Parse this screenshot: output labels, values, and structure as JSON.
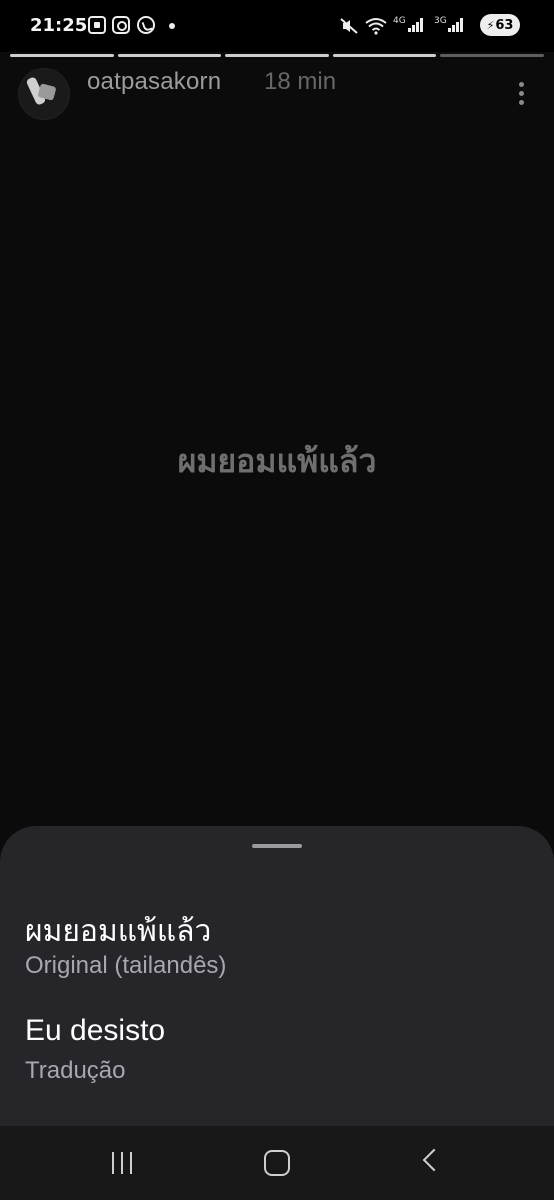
{
  "status_bar": {
    "time": "21:25",
    "left_icons": [
      "screenshot-icon",
      "instagram-icon",
      "whatsapp-icon"
    ],
    "network_labels": [
      "4G",
      "3G"
    ],
    "battery": "63"
  },
  "story": {
    "progress_segments": 5,
    "progress_done": 4,
    "username": "oatpasakorn",
    "time_ago": "18 min",
    "text": "ผมยอมแพ้แล้ว"
  },
  "translation_sheet": {
    "original_text": "ผมยอมแพ้แล้ว",
    "original_label": "Original (tailandês)",
    "translated_text": "Eu desisto",
    "translated_label": "Tradução"
  },
  "colors": {
    "sheet_bg": "#26262a",
    "background": "#0b0b0c",
    "label": "#a7a7ad"
  }
}
